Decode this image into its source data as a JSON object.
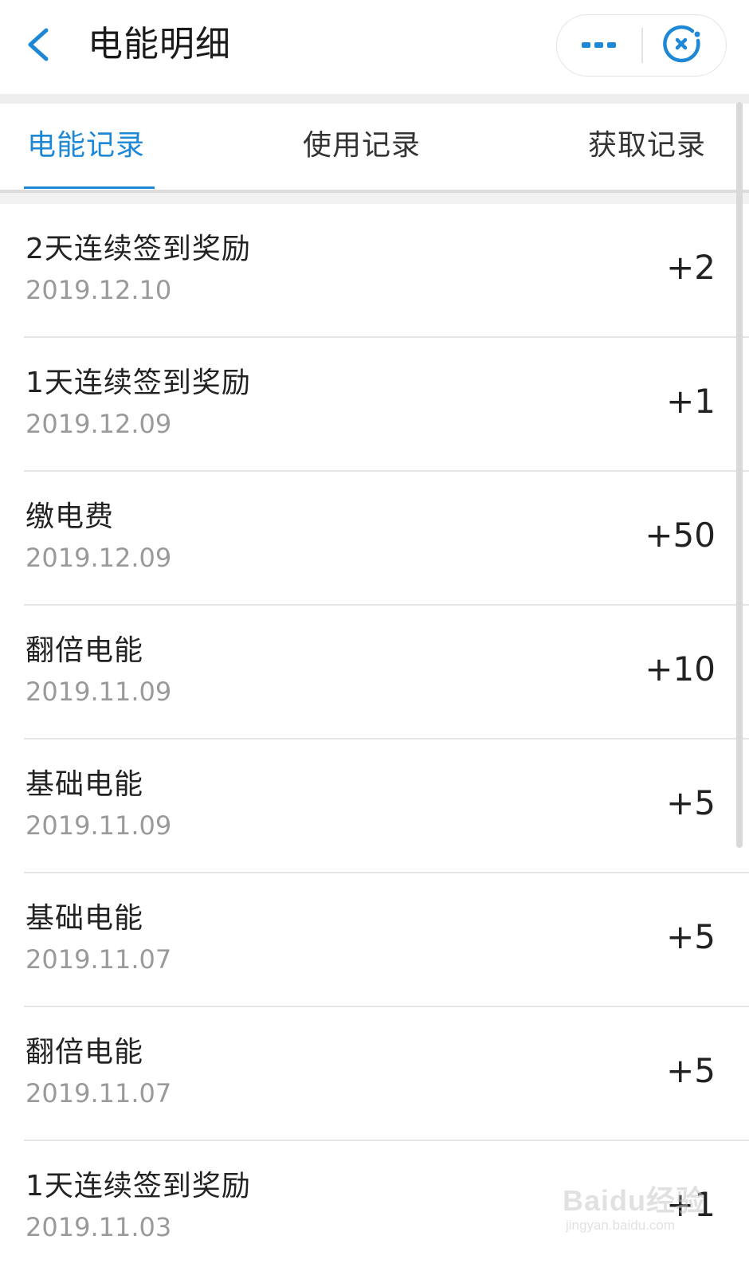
{
  "header": {
    "title": "电能明细",
    "back_icon": "chevron-left-icon",
    "more_icon": "more-dots-icon",
    "close_icon": "close-circle-icon"
  },
  "tabs": [
    {
      "label": "电能记录",
      "active": true
    },
    {
      "label": "使用记录",
      "active": false
    },
    {
      "label": "获取记录",
      "active": false
    }
  ],
  "colors": {
    "accent": "#1e88d6",
    "text_primary": "#222222",
    "text_secondary": "#9a9a9a",
    "divider": "#e6e6e6"
  },
  "records": [
    {
      "title": "2天连续签到奖励",
      "date": "2019.12.10",
      "amount": "+2"
    },
    {
      "title": "1天连续签到奖励",
      "date": "2019.12.09",
      "amount": "+1"
    },
    {
      "title": "缴电费",
      "date": "2019.12.09",
      "amount": "+50"
    },
    {
      "title": "翻倍电能",
      "date": "2019.11.09",
      "amount": "+10"
    },
    {
      "title": "基础电能",
      "date": "2019.11.09",
      "amount": "+5"
    },
    {
      "title": "基础电能",
      "date": "2019.11.07",
      "amount": "+5"
    },
    {
      "title": "翻倍电能",
      "date": "2019.11.07",
      "amount": "+5"
    },
    {
      "title": "1天连续签到奖励",
      "date": "2019.11.03",
      "amount": "+1"
    }
  ],
  "watermark": {
    "logo_text": "Baidu经验",
    "url_text": "jingyan.baidu.com"
  }
}
